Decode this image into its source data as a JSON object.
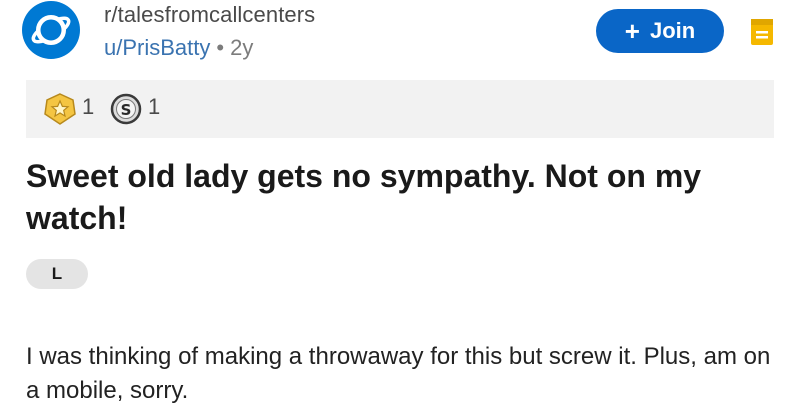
{
  "header": {
    "subreddit": "r/talesfromcallcenters",
    "username": "u/PrisBatty",
    "separator": "•",
    "age": "2y",
    "join_label": "Join",
    "join_icon": "+"
  },
  "awards": [
    {
      "icon": "gold-star-award-icon",
      "count": "1"
    },
    {
      "icon": "silver-s-award-icon",
      "count": "1"
    }
  ],
  "post": {
    "title": "Sweet old lady gets no sympathy. Not on my watch!",
    "flair": "L",
    "body": "I was thinking of making a throwaway for this but screw it. Plus, am on a mobile, sorry."
  },
  "colors": {
    "brand_blue": "#0079d3",
    "join_button": "#0a66c7",
    "username": "#3a73b0",
    "save_icon": "#f5b800",
    "awards_bar_bg": "#f2f2f2",
    "flair_bg": "#e4e4e4"
  }
}
